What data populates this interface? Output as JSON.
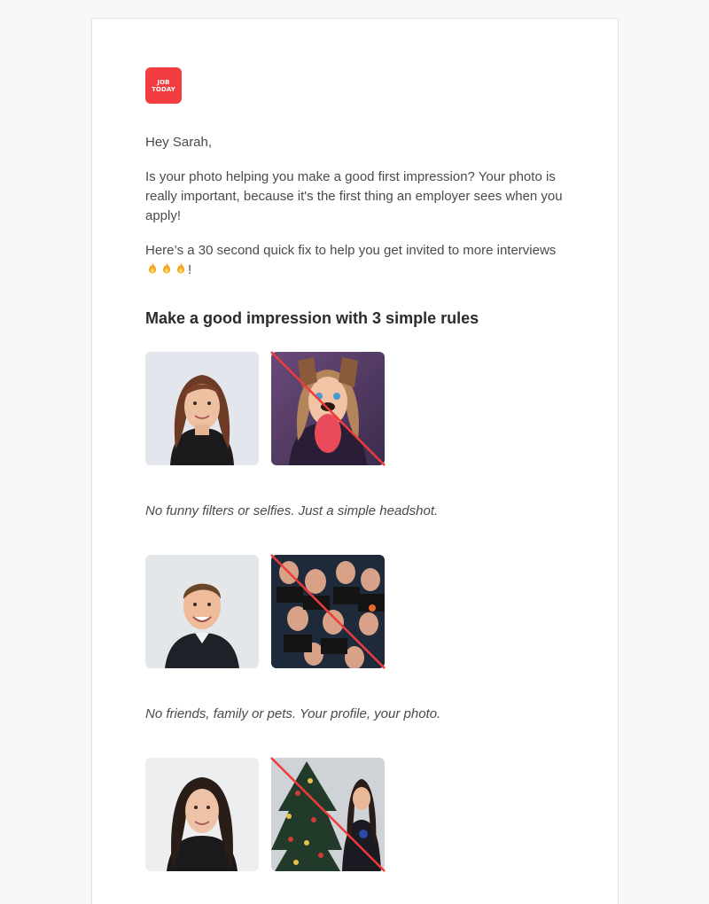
{
  "logo": {
    "line1": "JOB",
    "line2": "TODAY"
  },
  "email": {
    "greeting": "Hey Sarah,",
    "paragraph1": "Is your photo helping you make a good first impression? Your photo is really important, because it's the first thing an employer sees when you apply!",
    "paragraph2_text": "Here’s a 30 second quick fix to help you get invited to more interviews",
    "paragraph2_end": "!",
    "fire_emoji": "fire-icon",
    "heading": "Make a good impression with 3 simple rules"
  },
  "rules": [
    {
      "good_photo": "professional-headshot-woman",
      "bad_photo": "dog-filter-selfie",
      "caption": "No funny filters or selfies. Just a simple headshot."
    },
    {
      "good_photo": "professional-headshot-man",
      "bad_photo": "group-photo",
      "caption": "No friends, family or pets. Your profile, your photo."
    },
    {
      "good_photo": "professional-headshot-woman-dark-hair",
      "bad_photo": "christmas-tree-photo",
      "caption": ""
    }
  ],
  "colors": {
    "brand": "#f23c3f",
    "strike": "#ee3b3b",
    "text": "#4a4a4a",
    "heading": "#2b2b2b"
  }
}
